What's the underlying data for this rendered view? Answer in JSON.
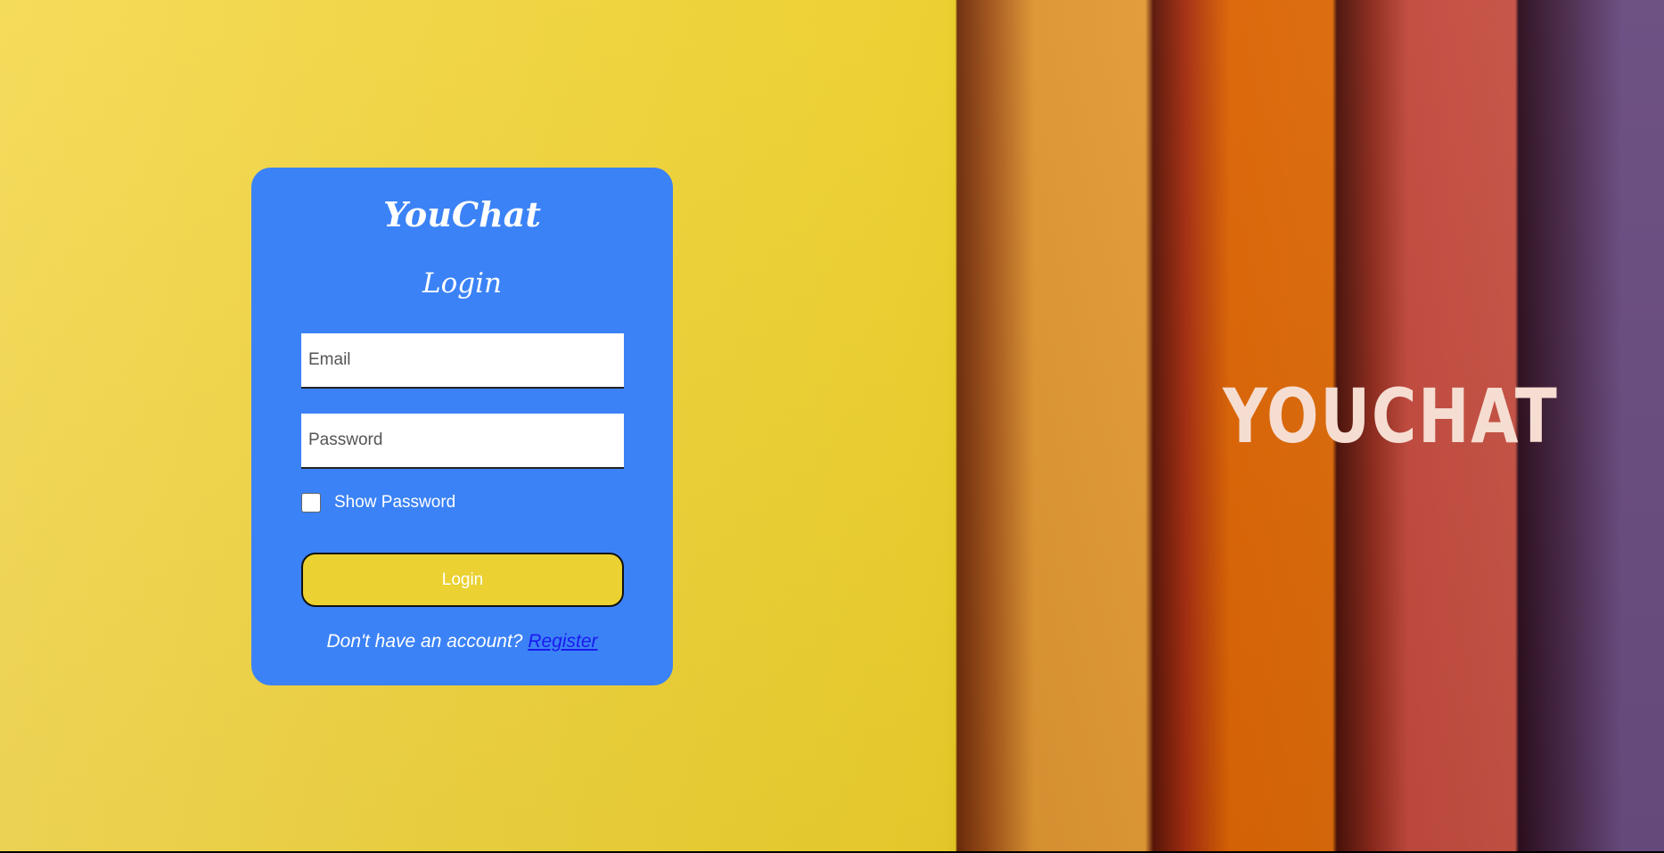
{
  "login_card": {
    "brand": "YouChat",
    "title": "Login",
    "email_placeholder": "Email",
    "email_value": "",
    "password_placeholder": "Password",
    "password_value": "",
    "show_password_label": "Show Password",
    "show_password_checked": false,
    "login_button_label": "Login",
    "footer_prompt": "Don't have an account?",
    "register_link": "Register"
  },
  "hero": {
    "logo_text": "YOUCHAT"
  },
  "colors": {
    "card_background": "#3b82f6",
    "login_button": "#ebd131",
    "link": "#1a1aee",
    "background_yellow": "#f0d440"
  }
}
